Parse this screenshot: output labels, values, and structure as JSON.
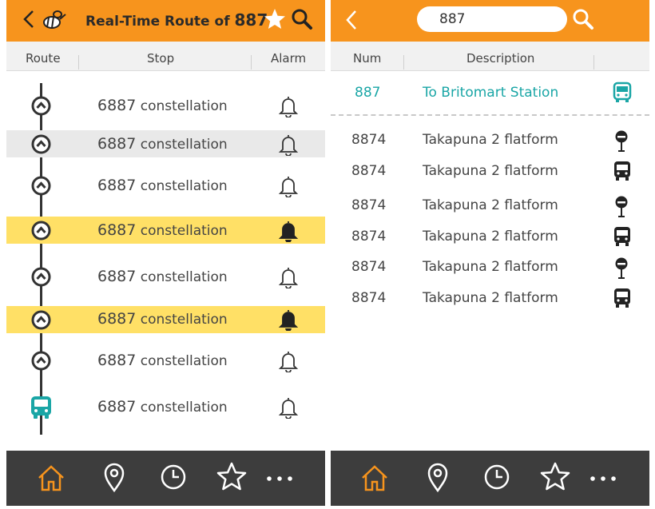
{
  "left": {
    "title_prefix": "Real-Time Route of",
    "route_number": "887",
    "columns": {
      "route": "Route",
      "stop": "Stop",
      "alarm": "Alarm"
    },
    "stops": [
      {
        "code": "6887",
        "name": "constellation",
        "alarm_on": false,
        "highlight": "none",
        "marker": "arrow"
      },
      {
        "code": "6887",
        "name": "constellation",
        "alarm_on": false,
        "highlight": "gray",
        "marker": "arrow"
      },
      {
        "code": "6887",
        "name": "constellation",
        "alarm_on": false,
        "highlight": "none",
        "marker": "arrow"
      },
      {
        "code": "6887",
        "name": "constellation",
        "alarm_on": true,
        "highlight": "yellow",
        "marker": "arrow"
      },
      {
        "code": "6887",
        "name": "constellation",
        "alarm_on": false,
        "highlight": "none",
        "marker": "arrow"
      },
      {
        "code": "6887",
        "name": "constellation",
        "alarm_on": true,
        "highlight": "yellow",
        "marker": "arrow"
      },
      {
        "code": "6887",
        "name": "constellation",
        "alarm_on": false,
        "highlight": "none",
        "marker": "arrow"
      },
      {
        "code": "6887",
        "name": "constellation",
        "alarm_on": false,
        "highlight": "none",
        "marker": "bus"
      }
    ]
  },
  "right": {
    "search": {
      "value": "887"
    },
    "columns": {
      "num": "Num",
      "description": "Description"
    },
    "top_result": {
      "num": "887",
      "description": "To Britomart Station",
      "icon": "bus-icon"
    },
    "results": [
      {
        "num": "8874",
        "description": "Takapuna 2 flatform",
        "icon": "bus-stop-icon"
      },
      {
        "num": "8874",
        "description": "Takapuna 2 flatform",
        "icon": "bus-icon"
      },
      {
        "num": "8874",
        "description": "Takapuna 2 flatform",
        "icon": "bus-stop-icon"
      },
      {
        "num": "8874",
        "description": "Takapuna 2 flatform",
        "icon": "bus-icon"
      },
      {
        "num": "8874",
        "description": "Takapuna 2 flatform",
        "icon": "bus-stop-icon"
      },
      {
        "num": "8874",
        "description": "Takapuna 2 flatform",
        "icon": "bus-icon"
      }
    ]
  },
  "nav": {
    "items": [
      "home-icon",
      "location-pin-icon",
      "clock-icon",
      "star-icon",
      "more-icon"
    ],
    "active": "home-icon"
  },
  "colors": {
    "accent": "#f7941d",
    "teal": "#1aa6a6",
    "highlight": "#ffe066",
    "navbar": "#3d3d3d"
  }
}
